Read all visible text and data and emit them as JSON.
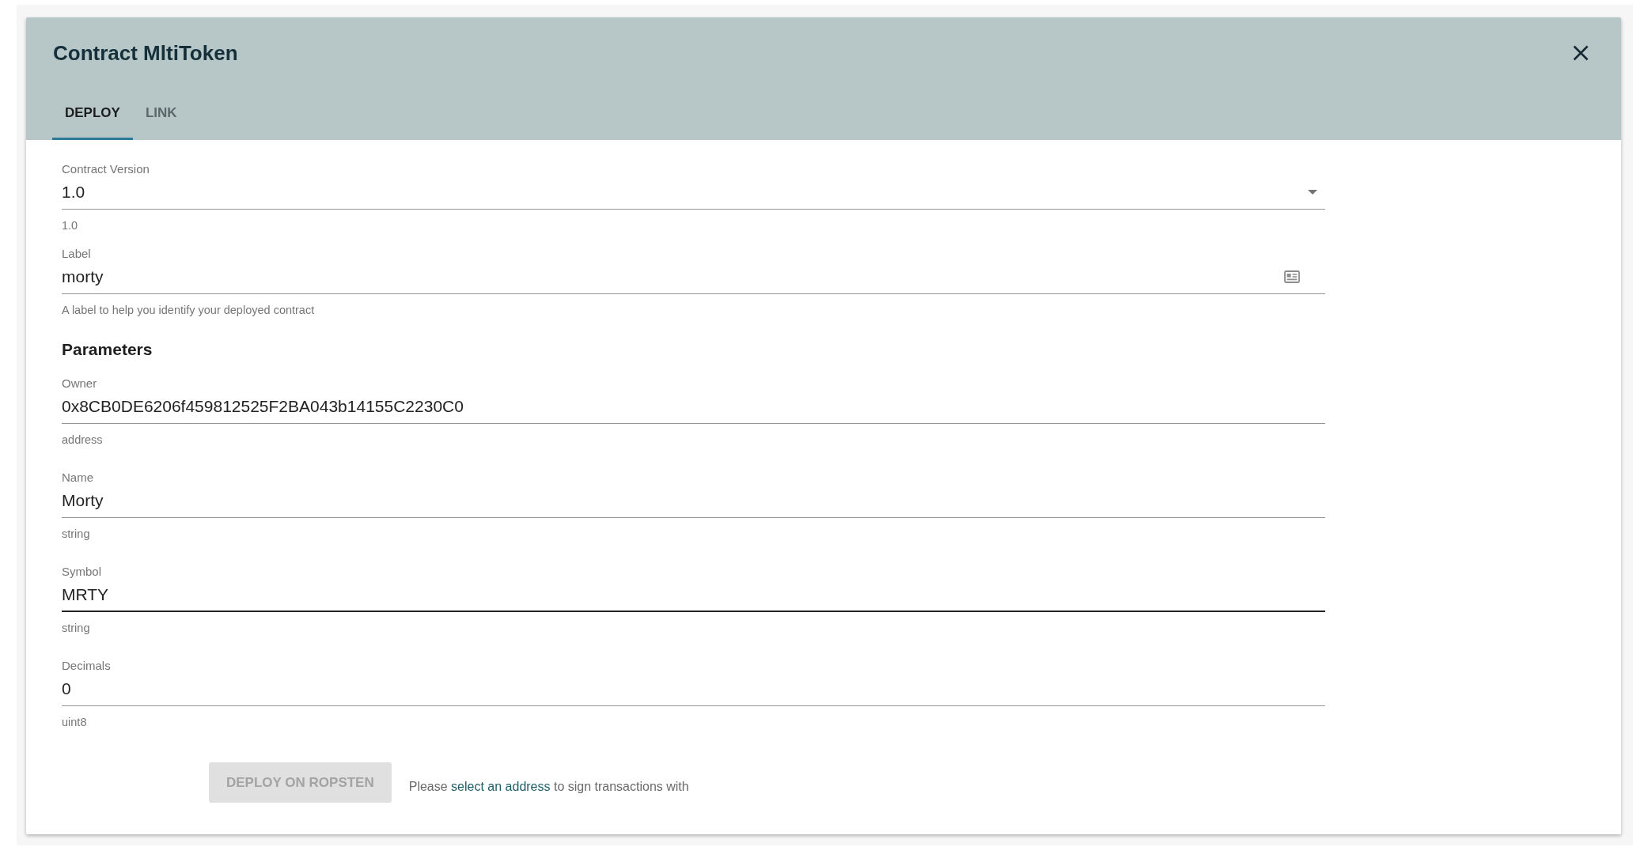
{
  "dialog": {
    "title": "Contract MltiToken"
  },
  "tabs": [
    {
      "label": "DEPLOY",
      "selected": true
    },
    {
      "label": "LINK",
      "selected": false
    }
  ],
  "fields": [
    {
      "kind": "select",
      "label": "Contract Version",
      "value": "1.0",
      "helper": "1.0",
      "hovered": false
    },
    {
      "kind": "adorned",
      "label": "Label",
      "value": "morty",
      "helper": "A label to help you identify your deployed contract",
      "hovered": false
    }
  ],
  "parameters": {
    "heading": "Parameters",
    "fields": [
      {
        "kind": "text",
        "label": "Owner",
        "value": "0x8CB0DE6206f459812525F2BA043b14155C2230C0",
        "helper": "address",
        "hovered": false
      },
      {
        "kind": "text",
        "label": "Name",
        "value": "Morty",
        "helper": "string",
        "hovered": false
      },
      {
        "kind": "text",
        "label": "Symbol",
        "value": "MRTY",
        "helper": "string",
        "hovered": true
      },
      {
        "kind": "text",
        "label": "Decimals",
        "value": "0",
        "helper": "uint8",
        "hovered": false
      }
    ]
  },
  "deploy_button": {
    "label": "DEPLOY ON ROPSTEN",
    "disabled": true
  },
  "notice": {
    "before": "Please",
    "link": "select an address",
    "after": "to sign transactions with"
  }
}
